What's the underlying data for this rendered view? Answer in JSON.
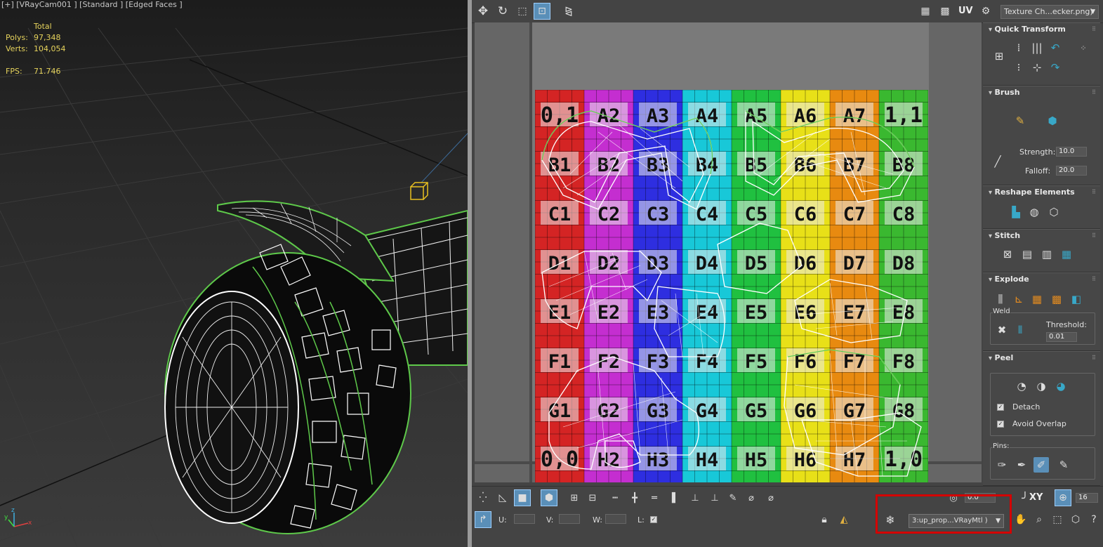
{
  "viewport": {
    "label": "[+] [VRayCam001 ] [Standard ] [Edged Faces ]",
    "stats": {
      "header": "Total",
      "polys_label": "Polys:",
      "polys_value": "97,348",
      "verts_label": "Verts:",
      "verts_value": "104,054",
      "fps_label": "FPS:",
      "fps_value": "71.746"
    },
    "axis": {
      "x": "x",
      "y": "y",
      "z": "z"
    }
  },
  "uv_editor": {
    "toolbar": {
      "uv_label": "UV",
      "texture_dropdown": "Texture Ch...ecker.png)"
    },
    "checker": {
      "rows": [
        "A",
        "B",
        "C",
        "D",
        "E",
        "F",
        "G",
        "H"
      ],
      "cols": [
        1,
        2,
        3,
        4,
        5,
        6,
        7,
        8
      ],
      "colors": [
        "#d42424",
        "#c42ed0",
        "#2e2ee0",
        "#18c8d8",
        "#20c040",
        "#e8e018",
        "#e88a10",
        "#3ab830"
      ],
      "corner_tl": "0,1",
      "corner_tr": "1,1",
      "corner_bl": "0,0",
      "corner_br": "1,0"
    },
    "panel": {
      "quick_transform": {
        "title": "Quick Transform"
      },
      "brush": {
        "title": "Brush",
        "strength_label": "Strength:",
        "strength_value": "10.0",
        "falloff_label": "Falloff:",
        "falloff_value": "20.0"
      },
      "reshape": {
        "title": "Reshape Elements"
      },
      "stitch": {
        "title": "Stitch"
      },
      "explode": {
        "title": "Explode",
        "weld_label": "Weld",
        "threshold_label": "Threshold:",
        "threshold_value": "0.01"
      },
      "peel": {
        "title": "Peel",
        "detach_label": "Detach",
        "avoid_overlap_label": "Avoid Overlap",
        "pins_label": "Pins:"
      }
    },
    "bottom": {
      "u_label": "U:",
      "v_label": "V:",
      "w_label": "W:",
      "l_label": "L:",
      "material_dropdown": "3:up_prop...VRayMtl )",
      "xy_label": "XY",
      "spin_value": "0.0",
      "grid_value": "16"
    }
  }
}
